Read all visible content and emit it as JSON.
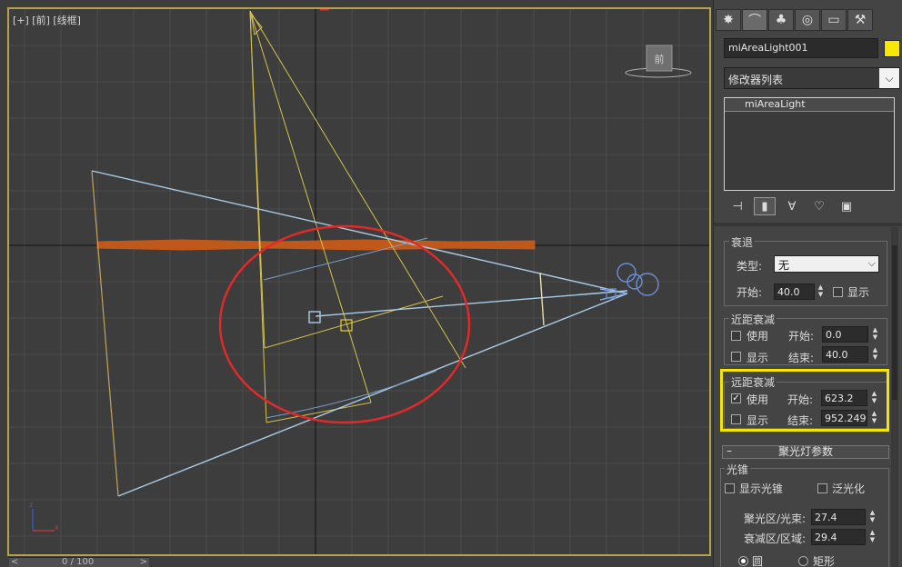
{
  "viewport": {
    "label": "[+] [前] [线框]",
    "view_cube_label": "前",
    "timeline": {
      "frame": "0 / 100",
      "left_arrow": "<",
      "right_arrow": ">"
    }
  },
  "panel": {
    "tabs": [
      {
        "icon": "create-icon",
        "glyph": "✸"
      },
      {
        "icon": "modify-icon",
        "glyph": "⌒"
      },
      {
        "icon": "hierarchy-icon",
        "glyph": "♣"
      },
      {
        "icon": "motion-icon",
        "glyph": "◎"
      },
      {
        "icon": "display-icon",
        "glyph": "▭"
      },
      {
        "icon": "utilities-icon",
        "glyph": "⚒"
      }
    ],
    "object_name": "miAreaLight001",
    "object_color": "#f7e800",
    "modifier_list": "修改器列表",
    "stack_item": "miAreaLight",
    "decay": {
      "title": "衰退",
      "type_label": "类型:",
      "type_value": "无",
      "start_label": "开始:",
      "start_value": "40.0",
      "show_label": "显示"
    },
    "near_atten": {
      "title": "近距衰减",
      "use_label": "使用",
      "use_checked": false,
      "show_label": "显示",
      "show_checked": false,
      "start_label": "开始:",
      "start_value": "0.0",
      "end_label": "结束:",
      "end_value": "40.0"
    },
    "far_atten": {
      "title": "远距衰减",
      "use_label": "使用",
      "use_checked": true,
      "show_label": "显示",
      "show_checked": false,
      "start_label": "开始:",
      "start_value": "623.2",
      "end_label": "结束:",
      "end_value": "952.249"
    },
    "spot_params": {
      "header": "聚光灯参数",
      "collapse": "–",
      "cone_title": "光锥",
      "show_cone": "显示光锥",
      "overshoot": "泛光化",
      "hotspot_label": "聚光区/光束:",
      "hotspot_value": "27.4",
      "falloff_label": "衰减区/区域:",
      "falloff_value": "29.4",
      "circle_label": "圆",
      "rect_label": "矩形"
    }
  },
  "colors": {
    "highlight": "#f5e600",
    "annotation_circle": "#e02a2a",
    "frame": "#b6a24a"
  }
}
